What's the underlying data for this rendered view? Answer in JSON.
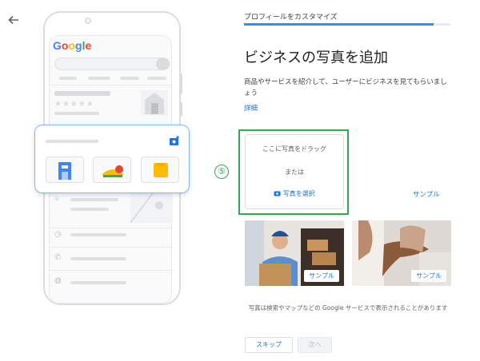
{
  "header": {
    "step_title": "プロフィールをカスタマイズ",
    "progress_fraction": 0.92
  },
  "main": {
    "title": "ビジネスの写真を追加",
    "description": "商品やサービスを紹介して、ユーザーにビジネスを見てもらいましょう",
    "learn_more": "詳細",
    "annotation": "⑤",
    "dropzone": {
      "drag_text": "ここに写真をドラッグ",
      "or_text": "または",
      "select_text": "写真を選択"
    },
    "sample_link": "サンプル",
    "samples": [
      {
        "label": "サンプル"
      },
      {
        "label": "サンプル"
      }
    ],
    "footnote": "写真は検索やマップなどの Google サービスで表示されることがあります",
    "buttons": {
      "skip": "スキップ",
      "next": "次へ"
    }
  },
  "illustration": {
    "logo": "Google",
    "stars": "★★★★★"
  },
  "icons": {
    "back": "arrow-left-icon",
    "camera": "add-photo-icon"
  },
  "colors": {
    "accent": "#1a73e8",
    "annotation": "#34a853",
    "progress": "#4285f4"
  }
}
